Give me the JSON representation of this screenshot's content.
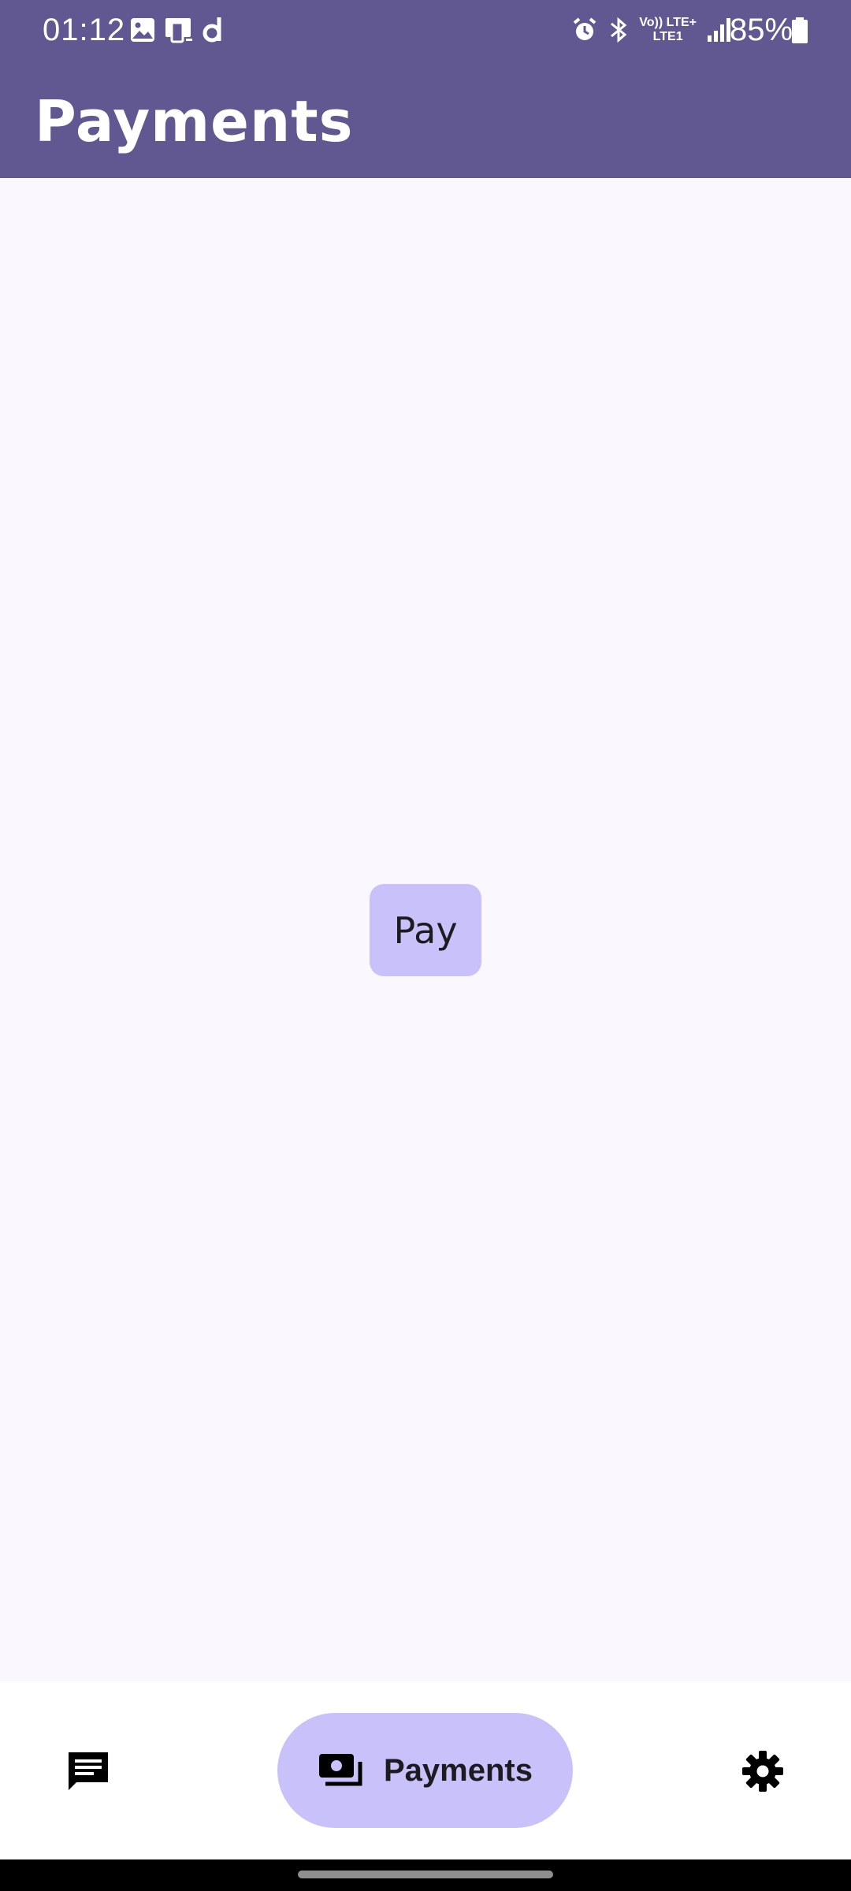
{
  "status_bar": {
    "time": "01:12",
    "battery_percent": "85%",
    "network_label_top": "Vo)) LTE+",
    "network_label_bottom": "LTE1",
    "left_icons": [
      "gallery-icon",
      "cast-icon",
      "app-d-icon"
    ],
    "right_icons": [
      "alarm-icon",
      "bluetooth-icon",
      "signal-icon",
      "battery-icon"
    ]
  },
  "app_bar": {
    "title": "Payments",
    "background_color": "#625891"
  },
  "main": {
    "pay_button_label": "Pay",
    "pay_button_color": "#C9C1FA"
  },
  "bottom_nav": {
    "items": [
      {
        "name": "messages",
        "icon": "message-icon",
        "label": "",
        "selected": false
      },
      {
        "name": "payments",
        "icon": "payments-icon",
        "label": "Payments",
        "selected": true
      },
      {
        "name": "settings",
        "icon": "gear-icon",
        "label": "",
        "selected": false
      }
    ]
  }
}
